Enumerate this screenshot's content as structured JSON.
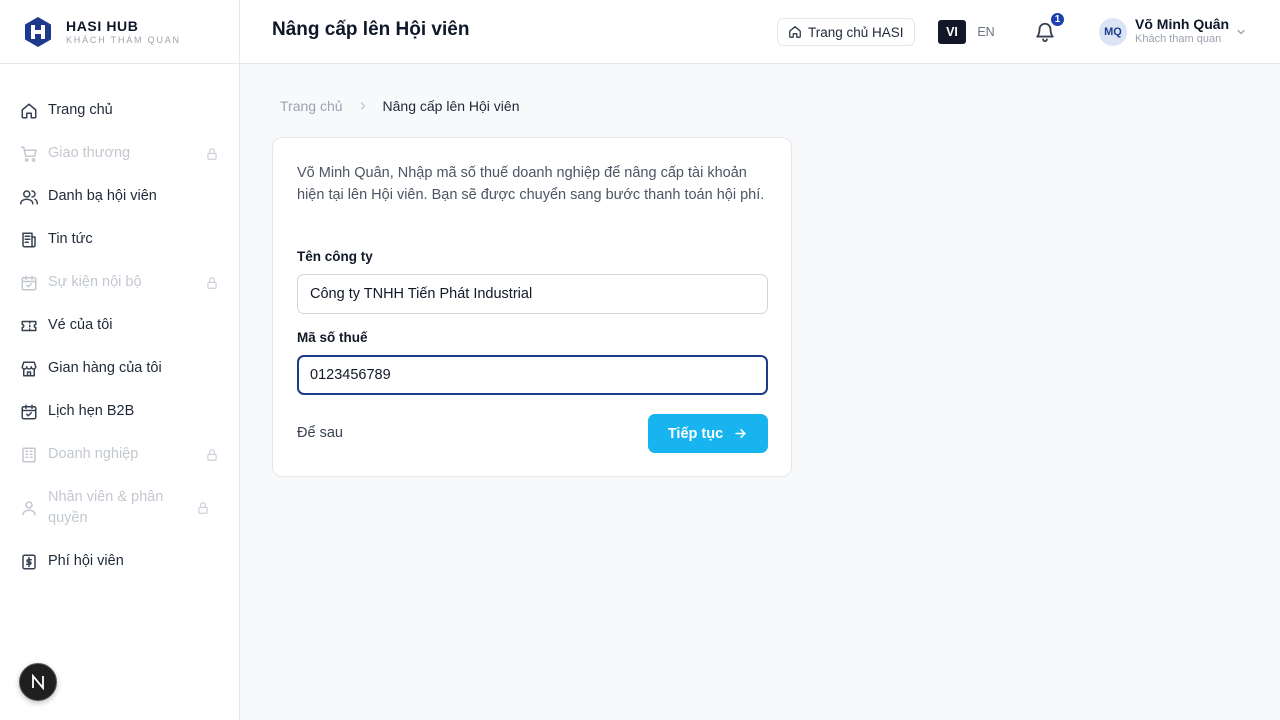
{
  "brand": {
    "name": "HASI HUB",
    "subtitle": "KHÁCH THAM QUAN",
    "accent": "#1e3a8a"
  },
  "sidebar": {
    "items": [
      {
        "label": "Trang chủ",
        "icon": "home-icon",
        "locked": false
      },
      {
        "label": "Giao thương",
        "icon": "cart-icon",
        "locked": true
      },
      {
        "label": "Danh bạ hội viên",
        "icon": "users-icon",
        "locked": false
      },
      {
        "label": "Tin tức",
        "icon": "newspaper-icon",
        "locked": false
      },
      {
        "label": "Sự kiện nội bộ",
        "icon": "calendar-check-icon",
        "locked": true
      },
      {
        "label": "Vé của tôi",
        "icon": "ticket-icon",
        "locked": false
      },
      {
        "label": "Gian hàng của tôi",
        "icon": "store-icon",
        "locked": false
      },
      {
        "label": "Lịch hẹn B2B",
        "icon": "calendar-icon",
        "locked": false
      },
      {
        "label": "Doanh nghiệp",
        "icon": "building-icon",
        "locked": true
      },
      {
        "label": "Nhân viên & phân quyền",
        "icon": "user-icon",
        "locked": true
      },
      {
        "label": "Phí hội viên",
        "icon": "dollar-receipt-icon",
        "locked": false
      }
    ],
    "fab_label": "N"
  },
  "header": {
    "title": "Nâng cấp lên Hội viên",
    "home_button": "Trang chủ HASI",
    "lang_vi": "VI",
    "lang_en": "EN",
    "notification_count": "1",
    "user": {
      "initials": "MQ",
      "name": "Võ Minh Quân",
      "role": "Khách tham quan"
    }
  },
  "breadcrumb": {
    "home": "Trang chủ",
    "current": "Nâng cấp lên Hội viên"
  },
  "form": {
    "intro": "Võ Minh Quân, Nhập mã số thuế doanh nghiệp để nâng cấp tài khoản hiện tại lên Hội viên. Bạn sẽ được chuyển sang bước thanh toán hội phí.",
    "company_label": "Tên công ty",
    "company_value": "Công ty TNHH Tiến Phát Industrial",
    "tax_label": "Mã số thuế",
    "tax_value": "0123456789",
    "later_label": "Để sau",
    "continue_label": "Tiếp tục",
    "primary_color": "#18b4f0"
  }
}
